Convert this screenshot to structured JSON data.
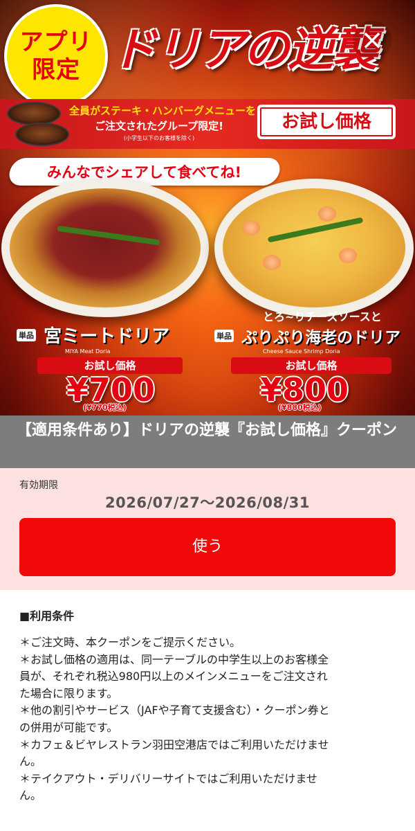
{
  "banner": {
    "app_only": [
      "アプリ",
      "限定"
    ],
    "title": "ドリアの逆襲",
    "close_icon": "×",
    "promo_line1": "全員がステーキ・ハンバーグメニューを",
    "promo_line2": "ご注文されたグループ限定!",
    "promo_note": "(小学生以下のお客様を除く)",
    "trial_label": "お試し価格",
    "share_text": "みんなでシェアして食べてね!",
    "items": [
      {
        "tag": "単品",
        "subtitle": "",
        "name": "宮ミートドリア",
        "name_en": "MIYA Meat Doria",
        "trial": "お試し価格",
        "price": "¥700",
        "price_tax": "(¥770税込)"
      },
      {
        "tag": "単品",
        "subtitle": "とろ~りチーズソースと",
        "name": "ぷりぷり海老のドリア",
        "name_en": "Cheese Sauce Shrimp Doria",
        "trial": "お試し価格",
        "price": "¥800",
        "price_tax": "(¥880税込)"
      }
    ]
  },
  "coupon": {
    "title": "【適用条件あり】ドリアの逆襲『お試し価格』クーポン",
    "validity_label": "有効期限",
    "validity_period": "2026/07/27〜2026/08/31",
    "use_button": "使う"
  },
  "terms": {
    "heading": "■利用条件",
    "lines": [
      "＊ご注文時、本クーポンをご提示ください。",
      "＊お試し価格の適用は、同一テーブルの中学生以上のお客様全",
      "員が、それぞれ税込980円以上のメインメニューをご注文され",
      "た場合に限ります。",
      "＊他の割引やサービス（JAFや子育て支援含む）・クーポン券と",
      "の併用が可能です。",
      "＊カフェ＆ビヤレストラン羽田空港店ではご利用いただけませ",
      "ん。",
      "＊テイクアウト・デリバリーサイトではご利用いただけませ",
      "ん。"
    ]
  },
  "colors": {
    "accent_red": "#f20a0a",
    "title_bar_gray": "#7d7d7d",
    "validity_bg": "#fde1e1"
  }
}
